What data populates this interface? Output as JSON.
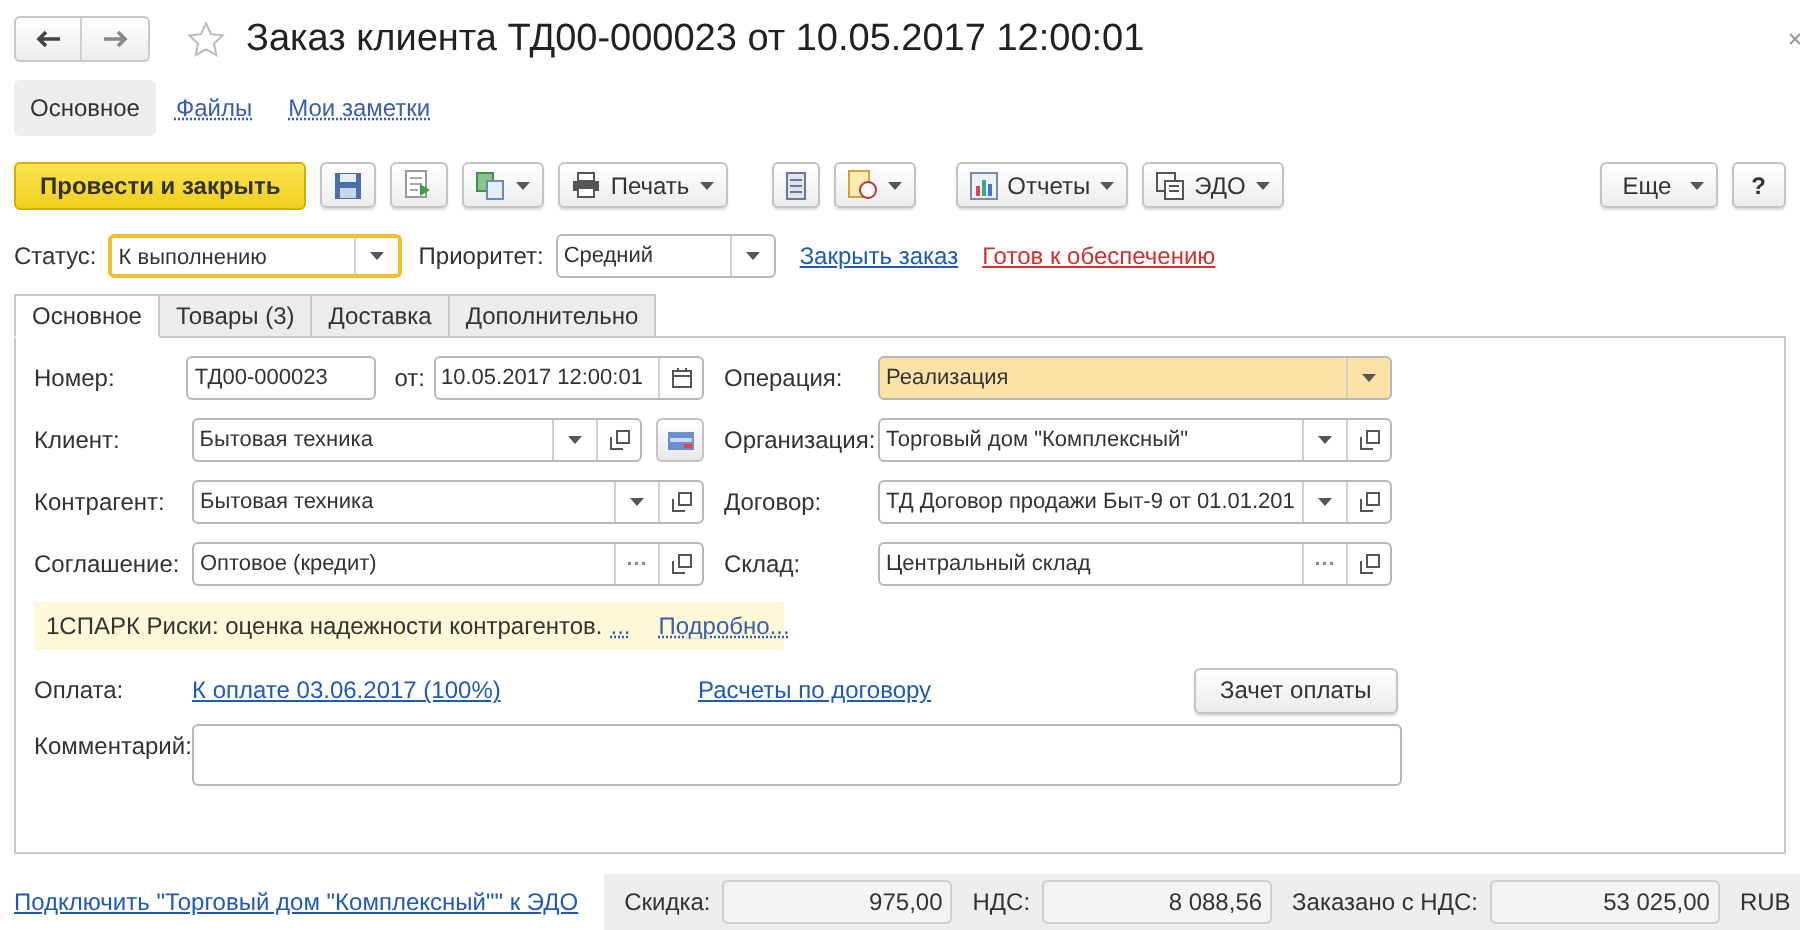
{
  "window": {
    "title": "Заказ клиента ТД00-000023 от 10.05.2017 12:00:01",
    "favorite": false
  },
  "nav_tabs": [
    {
      "label": "Основное",
      "selected": true
    },
    {
      "label": "Файлы",
      "selected": false
    },
    {
      "label": "Мои заметки",
      "selected": false
    }
  ],
  "toolbar": {
    "primary": "Провести и закрыть",
    "print": "Печать",
    "reports": "Отчеты",
    "edo": "ЭДО",
    "more": "Еще",
    "help": "?"
  },
  "status_row": {
    "status_label": "Статус:",
    "status_value": "К выполнению",
    "status_focused": true,
    "priority_label": "Приоритет:",
    "priority_value": "Средний",
    "links": [
      {
        "label": "Закрыть заказ",
        "color": "#1f5bb5"
      },
      {
        "label": "Готов к обеспечению",
        "color": "#d32f2f"
      }
    ]
  },
  "tabs": [
    {
      "label": "Основное",
      "selected": true
    },
    {
      "label": "Товары (3)",
      "selected": false
    },
    {
      "label": "Доставка",
      "selected": false
    },
    {
      "label": "Дополнительно",
      "selected": false
    }
  ],
  "number": {
    "label": "Номер:",
    "value": "ТД00-000023",
    "date_label": "от:",
    "date_value": "10.05.2017 12:00:01"
  },
  "left_fields": [
    {
      "label": "Клиент:",
      "value": "Бытовая техника",
      "dropdown": true,
      "select": false,
      "open": true,
      "extra_button": true
    },
    {
      "label": "Контрагент:",
      "value": "Бытовая техника",
      "dropdown": true,
      "select": false,
      "open": true,
      "extra_button": false
    },
    {
      "label": "Соглашение:",
      "value": "Оптовое (кредит)",
      "dropdown": false,
      "select": true,
      "open": true,
      "extra_button": false
    }
  ],
  "right_fields": [
    {
      "label": "Операция:",
      "value": "Реализация",
      "dropdown": true,
      "select": false,
      "open": false,
      "highlighted": true
    },
    {
      "label": "Организация:",
      "value": "Торговый дом \"Комплексный\"",
      "dropdown": true,
      "select": false,
      "open": true,
      "highlighted": false
    },
    {
      "label": "Договор:",
      "value": "ТД Договор продажи Быт-9 от 01.01.201",
      "dropdown": true,
      "select": false,
      "open": true,
      "highlighted": false
    },
    {
      "label": "Склад:",
      "value": "Центральный склад",
      "dropdown": false,
      "select": true,
      "open": true,
      "highlighted": false
    }
  ],
  "spark": {
    "text": "1СПАРК Риски: оценка надежности контрагентов.",
    "more_dots": "...",
    "link": "Подробно..."
  },
  "payment": {
    "label": "Оплата:",
    "link": "К оплате 03.06.2017 (100%)",
    "contract_link": "Расчеты по договору",
    "button": "Зачет оплаты"
  },
  "comment": {
    "label": "Комментарий:"
  },
  "footer": {
    "edo_link": "Подключить \"Торговый дом \"Комплексный\"\" к ЭДО",
    "totals": [
      {
        "label": "Скидка:",
        "value": "975,00"
      },
      {
        "label": "НДС:",
        "value": "8 088,56"
      },
      {
        "label": "Заказано с НДС:",
        "value": "53 025,00"
      }
    ],
    "currency": "RUB"
  }
}
